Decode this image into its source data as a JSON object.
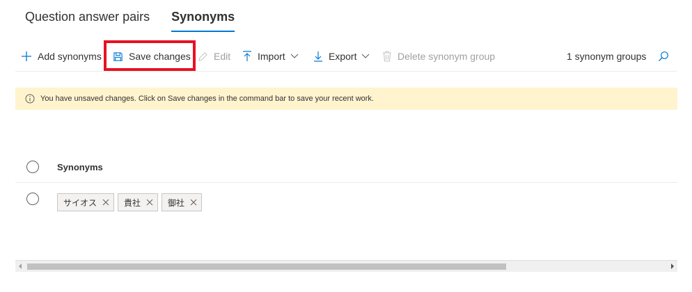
{
  "tabs": [
    {
      "label": "Question answer pairs",
      "active": false
    },
    {
      "label": "Synonyms",
      "active": true
    }
  ],
  "commandbar": {
    "add": {
      "label": "Add synonyms",
      "icon": "plus-icon"
    },
    "save": {
      "label": "Save changes",
      "icon": "save-icon"
    },
    "edit": {
      "label": "Edit",
      "icon": "pencil-icon"
    },
    "import": {
      "label": "Import",
      "icon": "upload-icon"
    },
    "export": {
      "label": "Export",
      "icon": "download-icon"
    },
    "delete": {
      "label": "Delete synonym group",
      "icon": "trash-icon"
    },
    "count": "1 synonym groups",
    "search_icon": "search-icon"
  },
  "banner": {
    "icon": "info-icon",
    "text": "You have unsaved changes. Click on Save changes in the command bar to save your recent work."
  },
  "grid": {
    "header": "Synonyms",
    "rows": [
      {
        "chips": [
          "サイオス",
          "貴社",
          "御社"
        ]
      }
    ]
  },
  "colors": {
    "accent": "#0078d4",
    "highlight": "#e81123",
    "banner_bg": "#fff4ce"
  }
}
